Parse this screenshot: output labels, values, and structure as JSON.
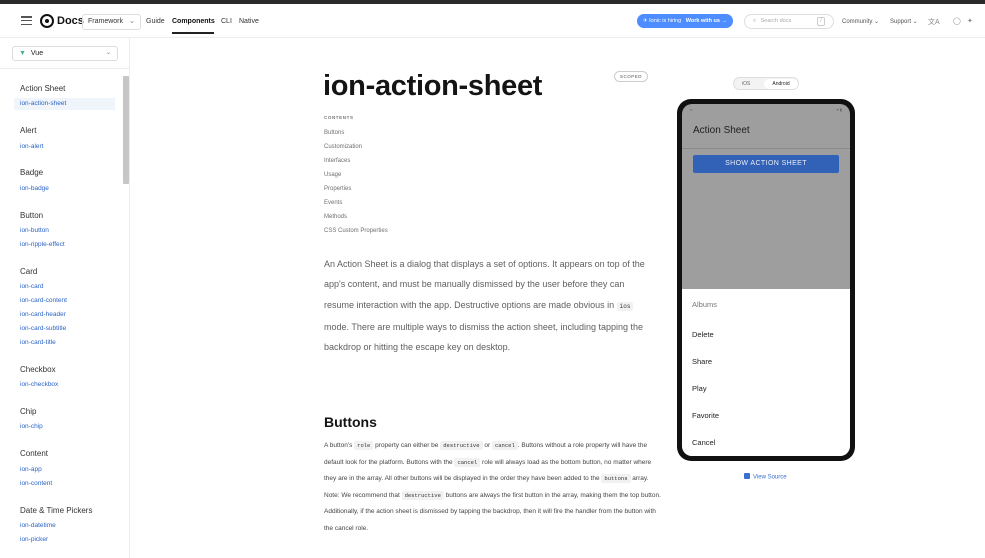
{
  "header": {
    "logo_text": "Docs",
    "framework_select": "Framework",
    "nav": [
      "Guide",
      "Components",
      "CLI",
      "Native"
    ],
    "active_nav": "Components",
    "hiring_text": "Ionic is hiring",
    "hiring_link": "Work with us",
    "search_placeholder": "Search docs",
    "search_key": "/",
    "community": "Community",
    "support": "Support"
  },
  "sidebar": {
    "framework": "Vue",
    "groups": [
      {
        "title": "Action Sheet",
        "items": [
          "ion-action-sheet"
        ]
      },
      {
        "title": "Alert",
        "items": [
          "ion-alert"
        ]
      },
      {
        "title": "Badge",
        "items": [
          "ion-badge"
        ]
      },
      {
        "title": "Button",
        "items": [
          "ion-button",
          "ion-ripple-effect"
        ]
      },
      {
        "title": "Card",
        "items": [
          "ion-card",
          "ion-card-content",
          "ion-card-header",
          "ion-card-subtitle",
          "ion-card-title"
        ]
      },
      {
        "title": "Checkbox",
        "items": [
          "ion-checkbox"
        ]
      },
      {
        "title": "Chip",
        "items": [
          "ion-chip"
        ]
      },
      {
        "title": "Content",
        "items": [
          "ion-app",
          "ion-content"
        ]
      },
      {
        "title": "Date & Time Pickers",
        "items": [
          "ion-datetime",
          "ion-picker"
        ]
      }
    ]
  },
  "main": {
    "badge": "SCOPED",
    "title": "ion-action-sheet",
    "contents_label": "CONTENTS",
    "toc": [
      "Buttons",
      "Customization",
      "Interfaces",
      "Usage",
      "Properties",
      "Events",
      "Methods",
      "CSS Custom Properties"
    ],
    "intro_1": "An Action Sheet is a dialog that displays a set of options. It appears on top of the app's content, and must be manually dismissed by the user before they can resume interaction with the app. Destructive options are made obvious in ",
    "intro_code": "ios",
    "intro_2": " mode. There are multiple ways to dismiss the action sheet, including tapping the backdrop or hitting the escape key on desktop.",
    "section_title": "Buttons",
    "b1": "A button's ",
    "c_role": "role",
    "b2": " property can either be ",
    "c_destructive": "destructive",
    "b3": " or ",
    "c_cancel": "cancel",
    "b4": ". Buttons without a role property will have the default look for the platform. Buttons with the ",
    "b5": " role will always load as the bottom button, no matter where they are in the array. All other buttons will be displayed in the order they have been added to the ",
    "c_buttons": "buttons",
    "b6": " array. Note: We recommend that ",
    "b7": " buttons are always the first button in the array, making them the top button. Additionally, if the action sheet is dismissed by tapping the backdrop, then it will fire the handler from the button with the cancel role."
  },
  "preview": {
    "toggle": [
      "iOS",
      "Android"
    ],
    "selected_platform": "Android",
    "app_title": "Action Sheet",
    "show_button": "SHOW ACTION SHEET",
    "sheet_title": "Albums",
    "sheet_buttons": [
      "Delete",
      "Share",
      "Play",
      "Favorite",
      "Cancel"
    ],
    "view_source": "View Source"
  }
}
